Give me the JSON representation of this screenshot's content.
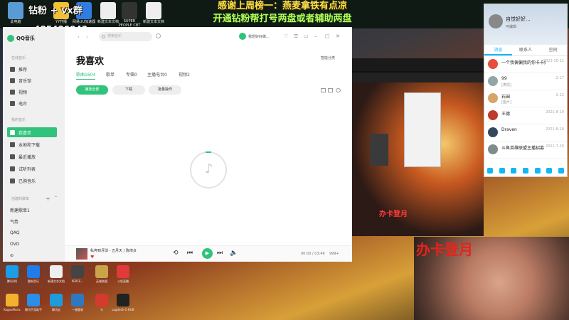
{
  "overlay": {
    "line1": "钻粉 + vx群",
    "phone": "485430943",
    "banner_line1": "感谢上周榜一：燕麦拿铁有点凉",
    "banner_line2": "开通钻粉帮打号两盘或者辅助两盘",
    "webcam_caption": "办卡登月",
    "preview_caption": "办卡登月"
  },
  "desktop_top": [
    {
      "label": "此电脑",
      "color": "#5a9bd5"
    },
    {
      "label": "YY开播",
      "color": "#f2c037"
    },
    {
      "label": "网易UU加速器",
      "color": "#2f7de1"
    },
    {
      "label": "新建文本文档",
      "color": "#eeeeee"
    },
    {
      "label": "SUPER PEOPLE CBT",
      "color": "#333333"
    },
    {
      "label": "新建文本文档",
      "color": "#eeeeee"
    }
  ],
  "qq": {
    "profile_name": "自觉好好...",
    "profile_sign": "可编辑",
    "tabs": [
      "消息",
      "联系人",
      "空间"
    ],
    "items": [
      {
        "name": "一个我偏偏我的你卡卡好",
        "msg": "",
        "time": "2023-10-11",
        "color": "#e74c3c"
      },
      {
        "name": "99",
        "msg": "[表情]",
        "time": "2-17",
        "color": "#95a5a6"
      },
      {
        "name": "石田",
        "msg": "[图片]",
        "time": "2-12",
        "color": "#d9a36b"
      },
      {
        "name": "王德",
        "msg": "",
        "time": "2021-8-19",
        "color": "#c0392b"
      },
      {
        "name": "Draven",
        "msg": "",
        "time": "2021-8-18",
        "color": "#34495e"
      },
      {
        "name": "斗鱼英雄联盟主播招募",
        "msg": "",
        "time": "2021-7-20",
        "color": "#7f8c8d"
      }
    ]
  },
  "player": {
    "app_name": "QQ音乐",
    "search_placeholder": "搜索音乐",
    "user_name": "我想好好做...",
    "page_title": "我喜欢",
    "smart_sort": "智能分类",
    "sidebar": {
      "section_online": "在线音乐",
      "online": [
        "推荐",
        "音乐馆",
        "视频",
        "电台"
      ],
      "section_mine": "我的音乐",
      "mine": [
        "我喜欢",
        "本地和下载",
        "最近播放",
        "试听列表",
        "已购音乐"
      ],
      "section_created": "创建的歌单",
      "playlists": [
        "新建歌单1",
        "气势",
        "QAQ",
        "OVO",
        "⊘"
      ]
    },
    "tabs": [
      "歌曲1604",
      "歌单",
      "专辑0",
      "主播电台0",
      "视频2"
    ],
    "buttons": {
      "play_all": "播放全部",
      "download": "下载",
      "batch": "批量操作"
    },
    "now_playing": {
      "title": "私奔到月球 - 五月天 / 陈绮贞",
      "time": "00:00 / 03:46",
      "count": "999+"
    }
  },
  "taskbar": [
    {
      "label": "腾讯QQ",
      "color": "#1a9ee5"
    },
    {
      "label": "酷狗音乐",
      "color": "#1f7ce8"
    },
    {
      "label": "新建文本文档",
      "color": "#eeeeee"
    },
    {
      "label": "PERCE...",
      "color": "#444444"
    },
    {
      "label": "英雄联盟",
      "color": "#c9a449"
    },
    {
      "label": "斗鱼直播",
      "color": "#e03a3a"
    },
    {
      "label": "KugouMusic",
      "color": "#f2b230"
    },
    {
      "label": "腾讯手游助手",
      "color": "#2b8ee8"
    },
    {
      "label": "腾讯云",
      "color": "#1f9bdc"
    },
    {
      "label": "一键重装",
      "color": "#2c79c0"
    },
    {
      "label": "卡",
      "color": "#d33b2c"
    },
    {
      "label": "Logitech G HUB",
      "color": "#222222"
    }
  ]
}
